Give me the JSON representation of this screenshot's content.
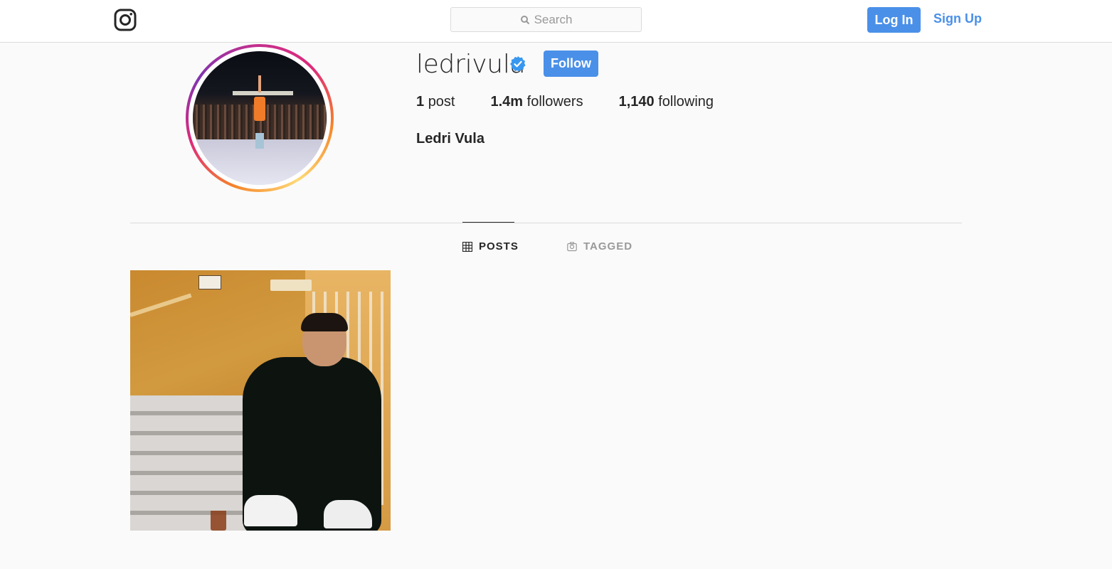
{
  "nav": {
    "search_placeholder": "Search",
    "login_label": "Log In",
    "signup_label": "Sign Up"
  },
  "profile": {
    "username": "ledrivula",
    "verified": true,
    "follow_label": "Follow",
    "full_name": "Ledri Vula",
    "stats": {
      "posts_count": "1",
      "posts_label": "post",
      "followers_count": "1.4m",
      "followers_label": "followers",
      "following_count": "1,140",
      "following_label": "following"
    }
  },
  "tabs": [
    {
      "label": "POSTS",
      "icon": "grid-icon",
      "active": true
    },
    {
      "label": "TAGGED",
      "icon": "tagged-icon",
      "active": false
    }
  ],
  "colors": {
    "accent": "#4a90e8",
    "text": "#262626",
    "muted": "#999999",
    "border": "#dbdbdb"
  }
}
